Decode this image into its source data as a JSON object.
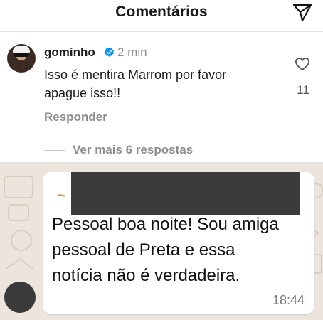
{
  "header": {
    "title": "Comentários",
    "send_icon": "send-icon"
  },
  "comment": {
    "username": "gominho",
    "verified": true,
    "time": "2 min",
    "text": "Isso é mentira Marrom por favor apague isso!!",
    "likes": "11",
    "reply_label": "Responder",
    "more_replies_label": "Ver mais 6 respostas"
  },
  "whatsapp": {
    "sender_prefix": "~ ",
    "message": "Pessoal boa noite! Sou amiga pessoal de Preta e essa notícia não é verdadeira.",
    "time": "18:44"
  },
  "colors": {
    "verified_blue": "#0095f6",
    "wa_background": "#ece5dd",
    "redaction": "#3b3b3b"
  }
}
